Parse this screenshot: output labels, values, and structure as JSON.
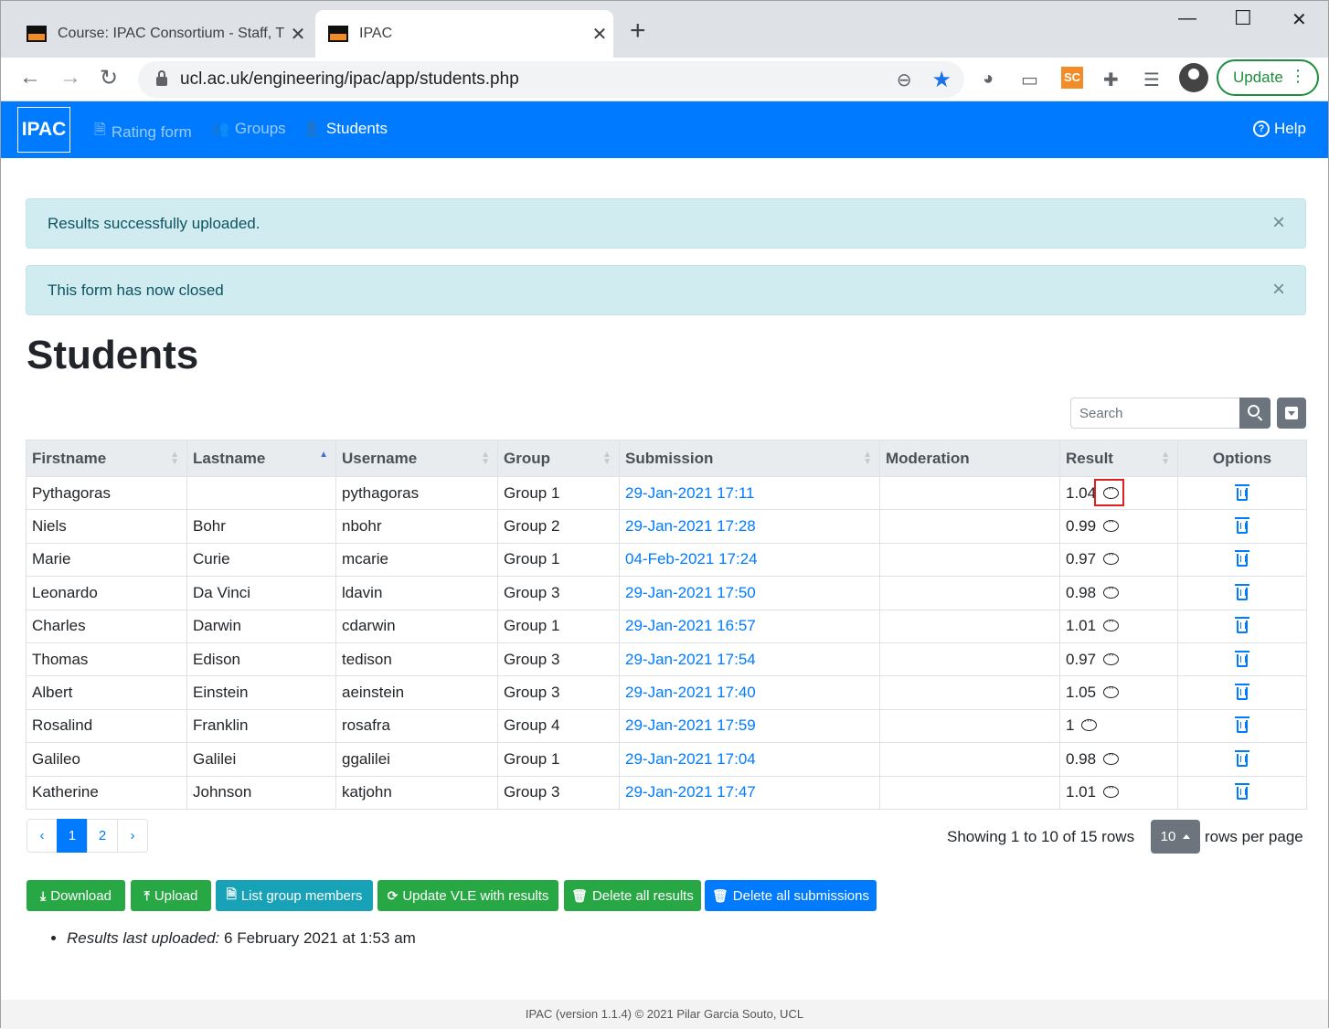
{
  "browser": {
    "tabs": [
      {
        "title": "Course: IPAC Consortium - Staff, T"
      },
      {
        "title": "IPAC"
      }
    ],
    "url": "ucl.ac.uk/engineering/ipac/app/students.php",
    "update_label": "Update",
    "extension_sc": "SC"
  },
  "nav": {
    "brand": "IPAC",
    "items": [
      {
        "label": "Rating form"
      },
      {
        "label": "Groups"
      },
      {
        "label": "Students"
      }
    ],
    "help": "Help"
  },
  "alerts": [
    {
      "text": "Results successfully uploaded."
    },
    {
      "text": "This form has now closed"
    }
  ],
  "page_title": "Students",
  "search": {
    "placeholder": "Search"
  },
  "table": {
    "columns": [
      "Firstname",
      "Lastname",
      "Username",
      "Group",
      "Submission",
      "Moderation",
      "Result",
      "Options"
    ],
    "rows": [
      {
        "firstname": "Pythagoras",
        "lastname": "",
        "username": "pythagoras",
        "group": "Group 1",
        "submission": "29-Jan-2021 17:11",
        "moderation": "",
        "result": "1.04"
      },
      {
        "firstname": "Niels",
        "lastname": "Bohr",
        "username": "nbohr",
        "group": "Group 2",
        "submission": "29-Jan-2021 17:28",
        "moderation": "",
        "result": "0.99"
      },
      {
        "firstname": "Marie",
        "lastname": "Curie",
        "username": "mcarie",
        "group": "Group 1",
        "submission": "04-Feb-2021 17:24",
        "moderation": "",
        "result": "0.97"
      },
      {
        "firstname": "Leonardo",
        "lastname": "Da Vinci",
        "username": "ldavin",
        "group": "Group 3",
        "submission": "29-Jan-2021 17:50",
        "moderation": "",
        "result": "0.98"
      },
      {
        "firstname": "Charles",
        "lastname": "Darwin",
        "username": "cdarwin",
        "group": "Group 1",
        "submission": "29-Jan-2021 16:57",
        "moderation": "",
        "result": "1.01"
      },
      {
        "firstname": "Thomas",
        "lastname": "Edison",
        "username": "tedison",
        "group": "Group 3",
        "submission": "29-Jan-2021 17:54",
        "moderation": "",
        "result": "0.97"
      },
      {
        "firstname": "Albert",
        "lastname": "Einstein",
        "username": "aeinstein",
        "group": "Group 3",
        "submission": "29-Jan-2021 17:40",
        "moderation": "",
        "result": "1.05"
      },
      {
        "firstname": "Rosalind",
        "lastname": "Franklin",
        "username": "rosafra",
        "group": "Group 4",
        "submission": "29-Jan-2021 17:59",
        "moderation": "",
        "result": "1"
      },
      {
        "firstname": "Galileo",
        "lastname": "Galilei",
        "username": "ggalilei",
        "group": "Group 1",
        "submission": "29-Jan-2021 17:04",
        "moderation": "",
        "result": "0.98"
      },
      {
        "firstname": "Katherine",
        "lastname": "Johnson",
        "username": "katjohn",
        "group": "Group 3",
        "submission": "29-Jan-2021 17:47",
        "moderation": "",
        "result": "1.01"
      }
    ]
  },
  "pagination": {
    "prev": "‹",
    "pages": [
      "1",
      "2"
    ],
    "next": "›",
    "showing": "Showing 1 to 10 of 15 rows",
    "page_size": "10",
    "rows_per_page": "rows per page"
  },
  "actions": [
    {
      "label": "Download"
    },
    {
      "label": "Upload"
    },
    {
      "label": "List group members"
    },
    {
      "label": "Update VLE with results"
    },
    {
      "label": "Delete all results"
    },
    {
      "label": "Delete all submissions"
    }
  ],
  "notes": {
    "label": "Results last uploaded:",
    "value": "6 February 2021 at 1:53 am"
  },
  "footer": "IPAC (version 1.1.4) © 2021 Pilar Garcia Souto, UCL",
  "colors": {
    "primary": "#007bff",
    "success": "#28a745",
    "info": "#17a2b8",
    "secondary": "#6c757d",
    "alert_bg": "#d1ecf1",
    "highlight": "#e02020"
  }
}
